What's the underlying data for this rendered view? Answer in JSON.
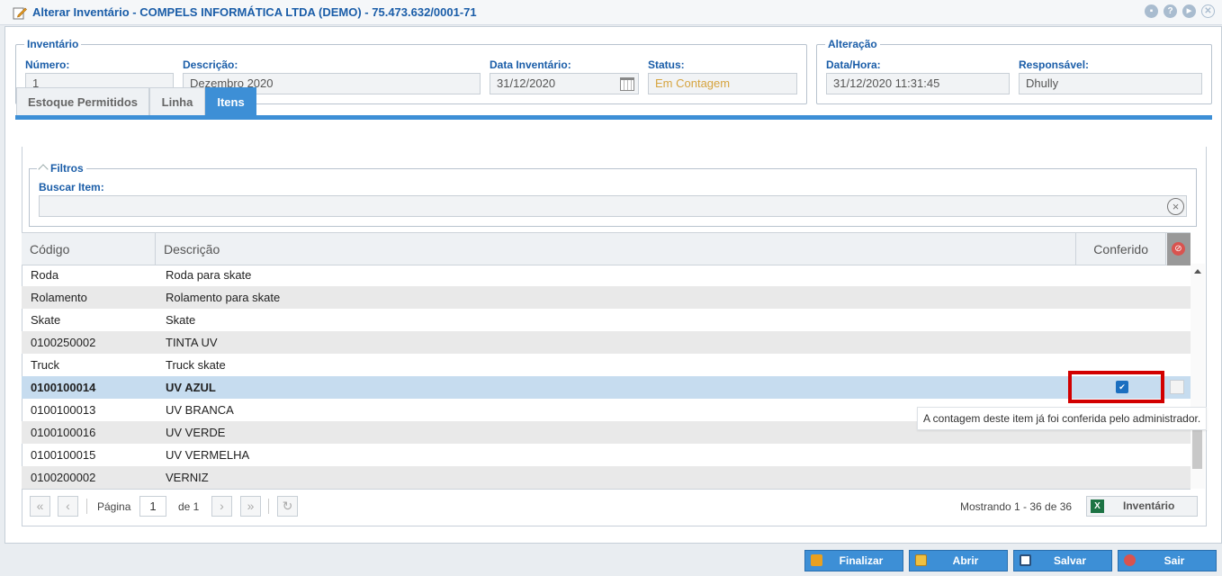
{
  "window": {
    "title": "Alterar Inventário - COMPELS INFORMÁTICA LTDA (DEMO) - 75.473.632/0001-71",
    "controls": {
      "help": "?",
      "play": "▶",
      "close": "✕"
    }
  },
  "inventario": {
    "legend": "Inventário",
    "numero_label": "Número:",
    "numero": "1",
    "descricao_label": "Descrição:",
    "descricao": "Dezembro 2020",
    "data_label": "Data Inventário:",
    "data": "31/12/2020",
    "status_label": "Status:",
    "status": "Em Contagem"
  },
  "alteracao": {
    "legend": "Alteração",
    "datahora_label": "Data/Hora:",
    "datahora": "31/12/2020 11:31:45",
    "responsavel_label": "Responsável:",
    "responsavel": "Dhully"
  },
  "tabs": [
    "Estoque Permitidos",
    "Linha",
    "Itens"
  ],
  "filters": {
    "legend": "Filtros",
    "buscar_label": "Buscar Item:",
    "buscar_value": ""
  },
  "grid": {
    "columns": [
      "Código",
      "Descrição",
      "Conferido"
    ],
    "rows": [
      {
        "codigo": "Roda",
        "descricao": "Roda para skate"
      },
      {
        "codigo": "Rolamento",
        "descricao": "Rolamento para skate"
      },
      {
        "codigo": "Skate",
        "descricao": "Skate"
      },
      {
        "codigo": "0100250002",
        "descricao": "TINTA UV"
      },
      {
        "codigo": "Truck",
        "descricao": "Truck skate"
      },
      {
        "codigo": "0100100014",
        "descricao": "UV AZUL"
      },
      {
        "codigo": "0100100013",
        "descricao": "UV BRANCA"
      },
      {
        "codigo": "0100100016",
        "descricao": "UV VERDE"
      },
      {
        "codigo": "0100100015",
        "descricao": "UV VERMELHA"
      },
      {
        "codigo": "0100200002",
        "descricao": "VERNIZ"
      }
    ],
    "tooltip": "A contagem deste item já foi conferida pelo administrador."
  },
  "pager": {
    "pagina_label": "Página",
    "pagina": "1",
    "de_label": "de 1",
    "mostrando": "Mostrando 1 - 36 de 36",
    "excel_label": "Inventário"
  },
  "footer": {
    "finalizar": "Finalizar",
    "abrir": "Abrir",
    "salvar": "Salvar",
    "sair": "Sair"
  },
  "colors": {
    "accent": "#3d8fd6",
    "label": "#1a5da8",
    "status": "#d6a43f",
    "highlight": "#d20000"
  }
}
